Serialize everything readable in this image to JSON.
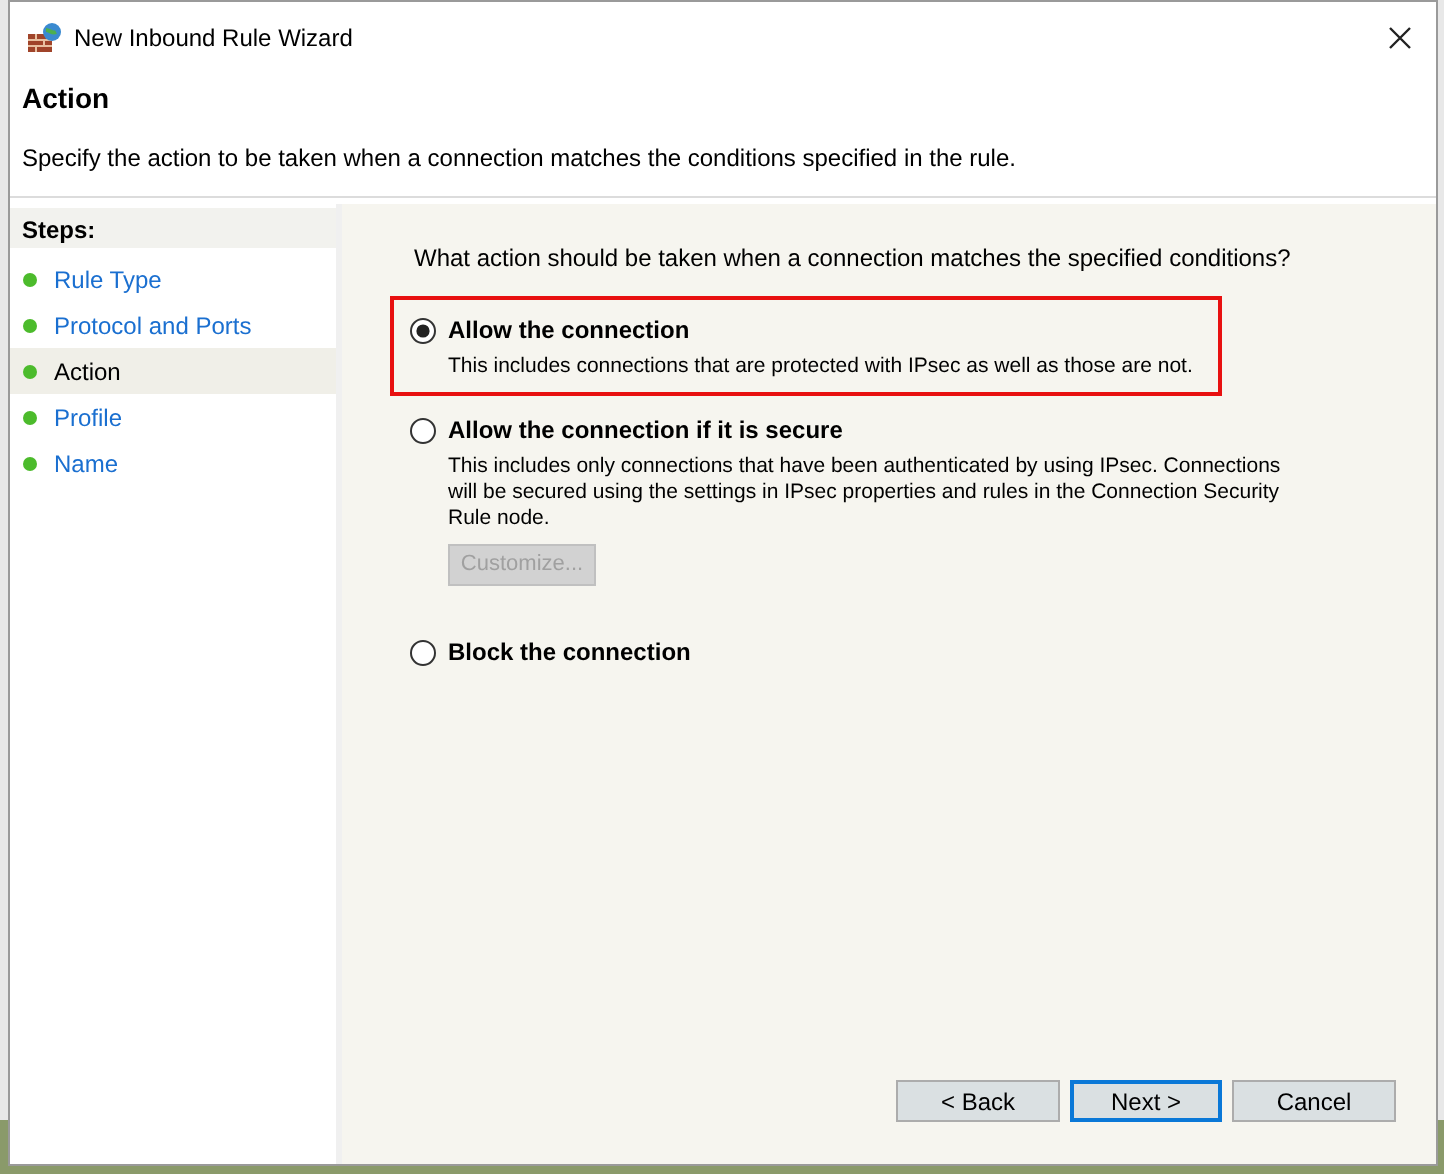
{
  "window": {
    "title": "New Inbound Rule Wizard"
  },
  "header": {
    "title": "Action",
    "description": "Specify the action to be taken when a connection matches the conditions specified in the rule."
  },
  "steps_title": "Steps:",
  "steps": [
    {
      "label": "Rule Type",
      "selected": false
    },
    {
      "label": "Protocol and Ports",
      "selected": false
    },
    {
      "label": "Action",
      "selected": true
    },
    {
      "label": "Profile",
      "selected": false
    },
    {
      "label": "Name",
      "selected": false
    }
  ],
  "question": "What action should be taken when a connection matches the specified conditions?",
  "options": [
    {
      "label": "Allow the connection",
      "description": "This includes connections that are protected with IPsec as well as those are not.",
      "selected": true,
      "highlighted": true
    },
    {
      "label": "Allow the connection if it is secure",
      "description": "This includes only connections that have been authenticated by using IPsec.  Connections will be secured using the settings in IPsec properties and rules in the Connection Security Rule node.",
      "selected": false,
      "highlighted": false,
      "button": {
        "label": "Customize...",
        "disabled": true
      }
    },
    {
      "label": "Block the connection",
      "selected": false,
      "highlighted": false
    }
  ],
  "buttons": [
    {
      "label": "< Back",
      "default": false
    },
    {
      "label": "Next >",
      "default": true
    },
    {
      "label": "Cancel",
      "default": false
    }
  ]
}
